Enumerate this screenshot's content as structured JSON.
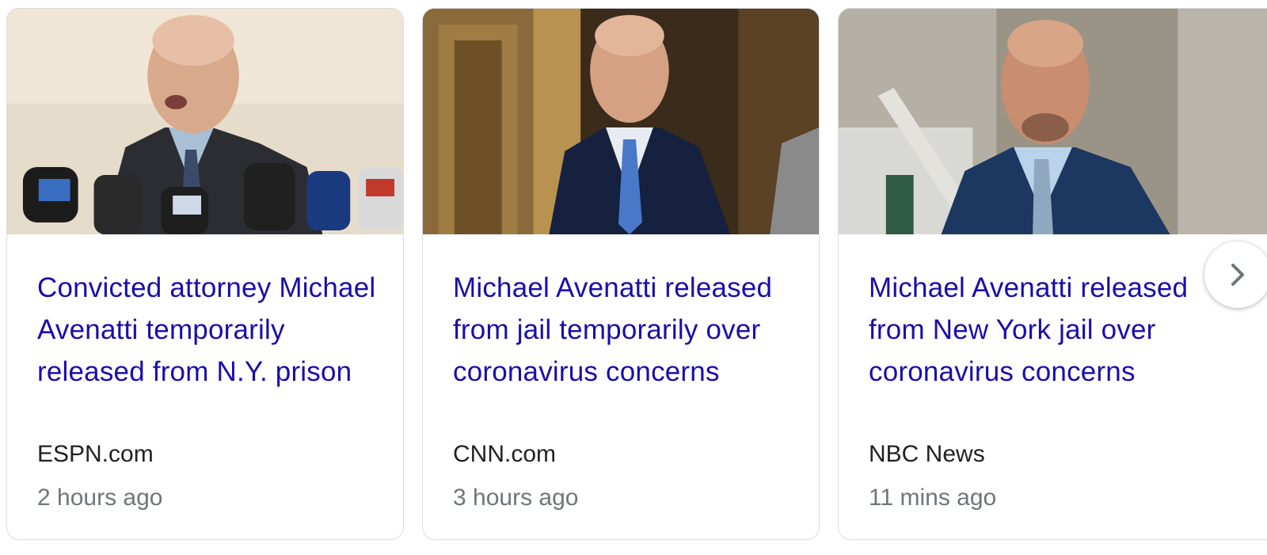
{
  "cards": [
    {
      "headline": "Convicted attorney Michael Avenatti temporarily released from N.Y. prison",
      "source": "ESPN.com",
      "time": "2 hours ago"
    },
    {
      "headline": "Michael Avenatti released from jail temporarily over coronavirus concerns",
      "source": "CNN.com",
      "time": "3 hours ago"
    },
    {
      "headline": "Michael Avenatti released from New York jail over coronavirus concerns",
      "source": "NBC News",
      "time": "11 mins ago"
    }
  ],
  "next_icon": "chevron-right-icon",
  "colors": {
    "link": "#1a0dab",
    "source": "#202124",
    "time": "#70757a",
    "border": "#dadce0"
  }
}
